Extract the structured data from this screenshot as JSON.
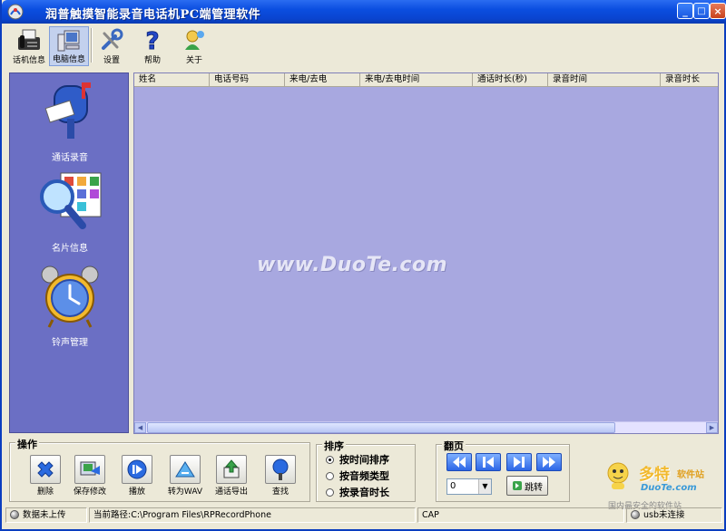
{
  "app": {
    "title": "润普触摸智能录音电话机PC端管理软件",
    "icon": "app-icon"
  },
  "window_controls": {
    "minimize": "_",
    "maximize": "□",
    "close": "×"
  },
  "toolbar": {
    "items": [
      {
        "label": "话机信息",
        "icon": "fax-phone-icon"
      },
      {
        "label": "电脑信息",
        "icon": "computer-icon"
      },
      {
        "label": "设置",
        "icon": "tools-icon"
      },
      {
        "label": "帮助",
        "icon": "help-icon"
      },
      {
        "label": "关于",
        "icon": "about-icon"
      }
    ]
  },
  "sidebar": {
    "items": [
      {
        "label": "通话录音",
        "icon": "mailbox-icon"
      },
      {
        "label": "名片信息",
        "icon": "search-cards-icon"
      },
      {
        "label": "铃声管理",
        "icon": "alarm-clock-icon"
      }
    ]
  },
  "list": {
    "columns": [
      "姓名",
      "电话号码",
      "来电/去电",
      "来电/去电时间",
      "通话时长(秒)",
      "录音时间",
      "录音时长"
    ],
    "rows": [],
    "background": "#a8a8e0"
  },
  "watermark": "www.DuoTe.com",
  "operations": {
    "title": "操作",
    "buttons": [
      {
        "label": "删除",
        "icon": "delete-icon"
      },
      {
        "label": "保存修改",
        "icon": "save-icon"
      },
      {
        "label": "播放",
        "icon": "play-icon"
      },
      {
        "label": "转为WAV",
        "icon": "convert-wav-icon"
      },
      {
        "label": "通话导出",
        "icon": "export-icon"
      },
      {
        "label": "查找",
        "icon": "find-icon"
      }
    ]
  },
  "sort": {
    "title": "排序",
    "options": [
      {
        "label": "按时间排序",
        "selected": true
      },
      {
        "label": "按音频类型",
        "selected": false
      },
      {
        "label": "按录音时长",
        "selected": false
      }
    ]
  },
  "paging": {
    "title": "翻页",
    "page_value": "0",
    "jump_label": "跳转",
    "nav": [
      "first-page-icon",
      "prev-page-icon",
      "next-page-icon",
      "last-page-icon"
    ]
  },
  "status": {
    "upload": "数据未上传",
    "path": "当前路径:C:\\Program Files\\RPRecordPhone",
    "cap": "CAP",
    "usb": "usb未连接"
  },
  "logo": {
    "text_cn": "多特",
    "text_suffix": "软件站",
    "site": "DuoTe.com",
    "slogan": "国内最安全的软件站"
  },
  "colors": {
    "titlebar": "#0b4ee0",
    "sidebar": "#6b6fc4",
    "list_bg": "#a8a8e0",
    "face": "#ece9d8"
  }
}
